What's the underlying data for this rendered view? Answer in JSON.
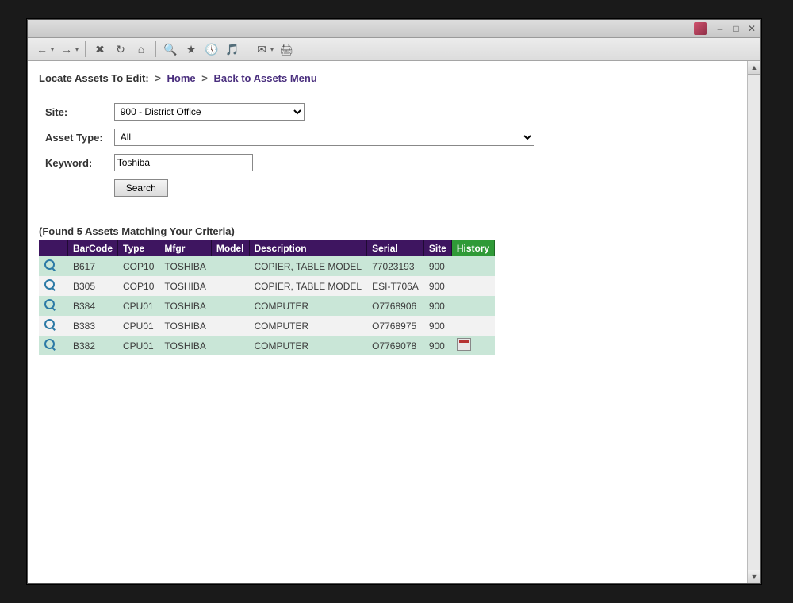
{
  "breadcrumb": {
    "prefix": "Locate Assets To Edit:",
    "home": "Home",
    "back": "Back to Assets Menu"
  },
  "form": {
    "site_label": "Site:",
    "site_value": "900 - District Office",
    "type_label": "Asset Type:",
    "type_value": "All",
    "keyword_label": "Keyword:",
    "keyword_value": "Toshiba",
    "search_label": "Search"
  },
  "results": {
    "heading": "(Found 5 Assets Matching Your Criteria)",
    "columns": {
      "barcode": "BarCode",
      "type": "Type",
      "mfgr": "Mfgr",
      "model": "Model",
      "description": "Description",
      "serial": "Serial",
      "site": "Site",
      "history": "History"
    },
    "rows": [
      {
        "barcode": "B617",
        "type": "COP10",
        "mfgr": "TOSHIBA",
        "model": "",
        "description": "COPIER, TABLE MODEL",
        "serial": "77023193",
        "site": "900",
        "history": false
      },
      {
        "barcode": "B305",
        "type": "COP10",
        "mfgr": "TOSHIBA",
        "model": "",
        "description": "COPIER, TABLE MODEL",
        "serial": "ESI-T706A",
        "site": "900",
        "history": false
      },
      {
        "barcode": "B384",
        "type": "CPU01",
        "mfgr": "TOSHIBA",
        "model": "",
        "description": "COMPUTER",
        "serial": "O7768906",
        "site": "900",
        "history": false
      },
      {
        "barcode": "B383",
        "type": "CPU01",
        "mfgr": "TOSHIBA",
        "model": "",
        "description": "COMPUTER",
        "serial": "O7768975",
        "site": "900",
        "history": false
      },
      {
        "barcode": "B382",
        "type": "CPU01",
        "mfgr": "TOSHIBA",
        "model": "",
        "description": "COMPUTER",
        "serial": "O7769078",
        "site": "900",
        "history": true
      }
    ]
  }
}
